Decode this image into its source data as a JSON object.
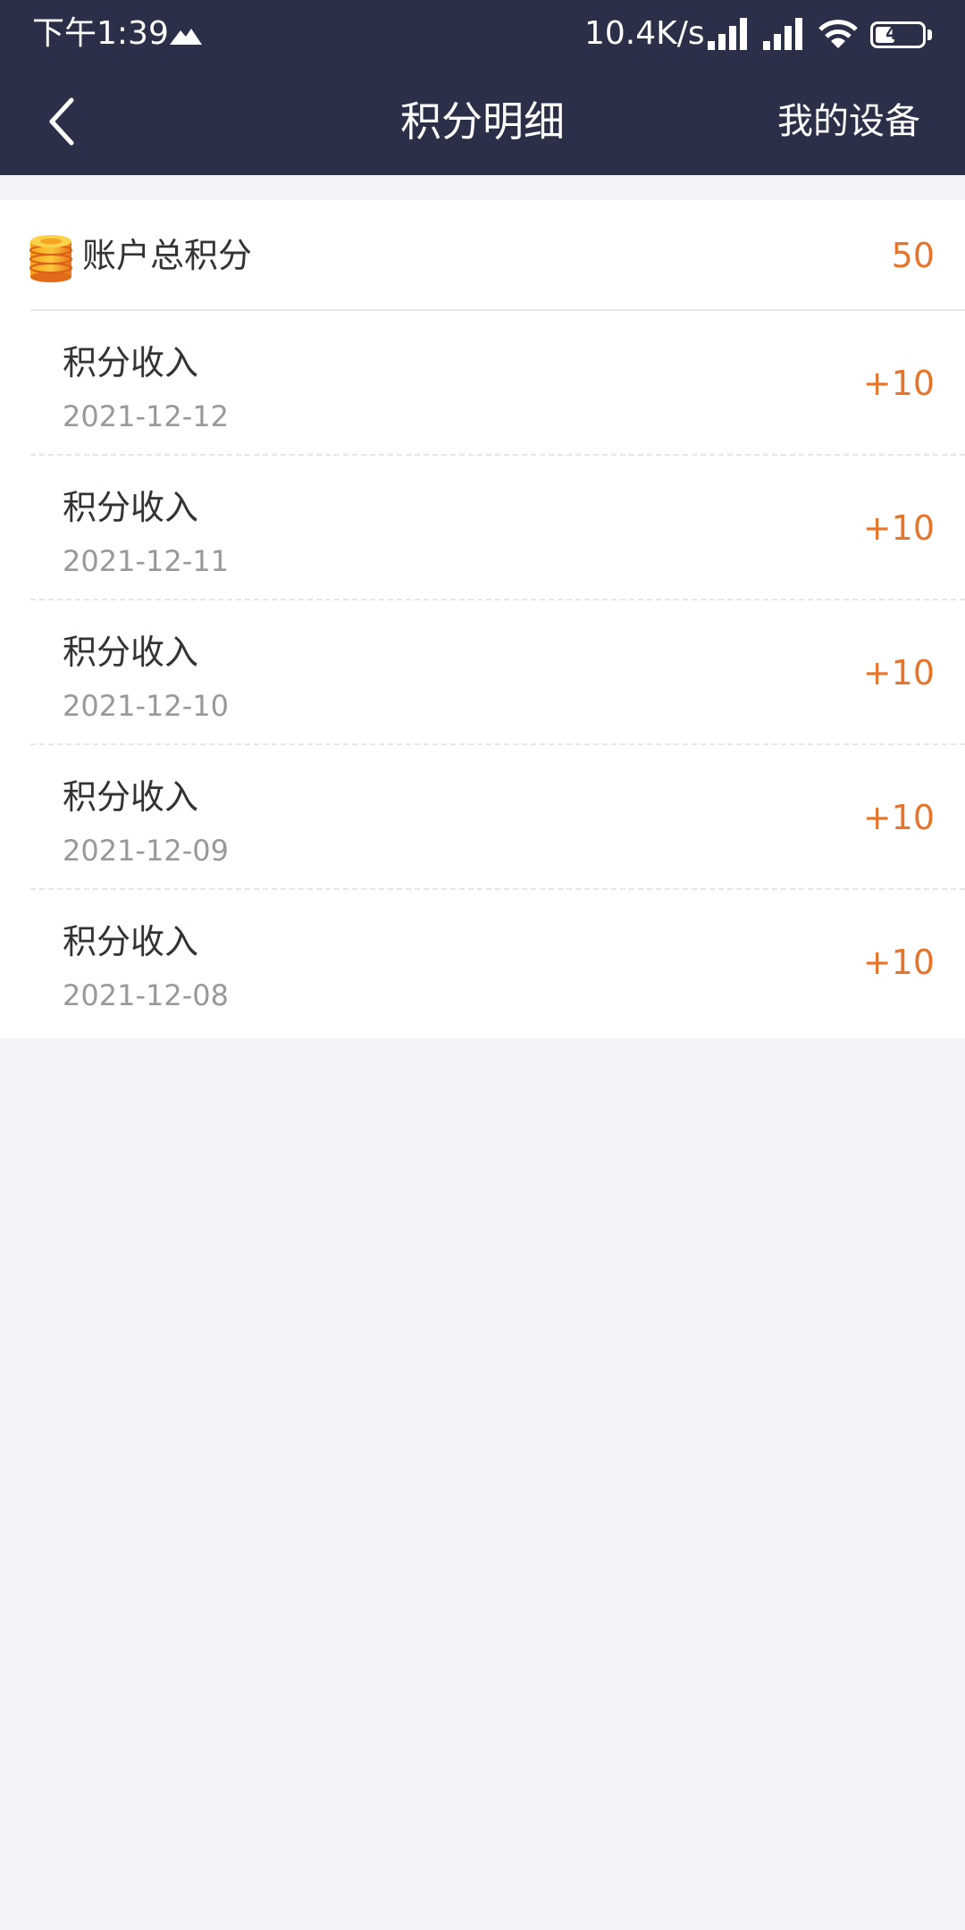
{
  "status_bar": {
    "time": "下午1:39",
    "net_speed": "10.4K/s",
    "battery": "41",
    "battery_level": 0.41
  },
  "nav": {
    "title": "积分明细",
    "right_label": "我的设备"
  },
  "summary": {
    "label": "账户总积分",
    "value": "50"
  },
  "records": [
    {
      "title": "积分收入",
      "date": "2021-12-12",
      "points": "+10"
    },
    {
      "title": "积分收入",
      "date": "2021-12-11",
      "points": "+10"
    },
    {
      "title": "积分收入",
      "date": "2021-12-10",
      "points": "+10"
    },
    {
      "title": "积分收入",
      "date": "2021-12-09",
      "points": "+10"
    },
    {
      "title": "积分收入",
      "date": "2021-12-08",
      "points": "+10"
    }
  ],
  "colors": {
    "header_bg": "#2c2f48",
    "accent": "#e6742a",
    "page_bg": "#f3f4f8"
  }
}
